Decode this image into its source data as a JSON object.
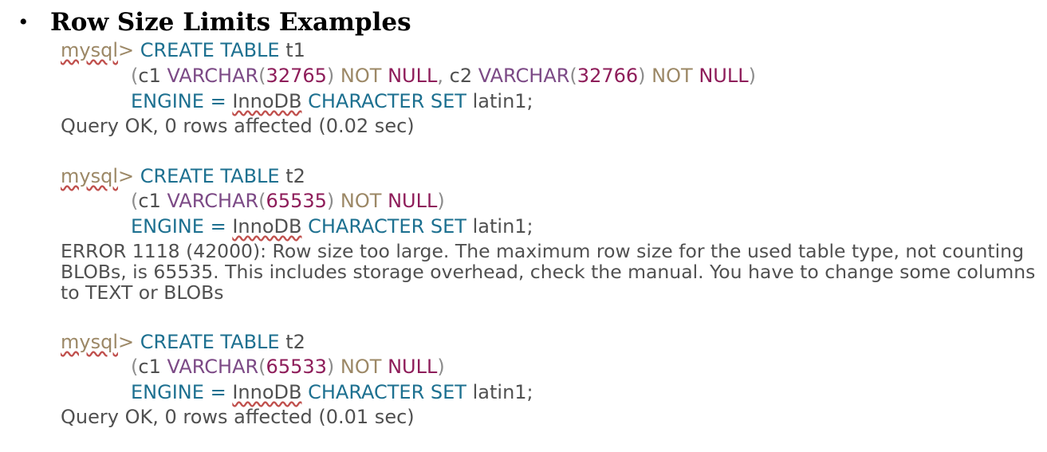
{
  "slide": {
    "bullet": "•",
    "title": "Row Size Limits Examples"
  },
  "examples": [
    {
      "prompt": "mysql",
      "prompt_gt": ">",
      "create": "CREATE TABLE",
      "table": "t1",
      "cols_open": "(",
      "col1": "c1",
      "col1_type": "VARCHAR",
      "col1_lp": "(",
      "col1_len": "32765",
      "col1_rp": ")",
      "col1_not": "NOT",
      "col1_null": "NULL",
      "sep": ",",
      "col2": "c2",
      "col2_type": "VARCHAR",
      "col2_lp": "(",
      "col2_len": "32766",
      "col2_rp": ")",
      "col2_not": "NOT",
      "col2_null": "NULL",
      "cols_close": ")",
      "engine": "ENGINE",
      "eq": "=",
      "innodb": "InnoDB",
      "charset": "CHARACTER SET",
      "latin": "latin1;",
      "result": "Query OK, 0 rows affected (0.02 sec)"
    },
    {
      "prompt": "mysql",
      "prompt_gt": ">",
      "create": "CREATE TABLE",
      "table": "t2",
      "cols_open": "(",
      "col1": "c1",
      "col1_type": "VARCHAR",
      "col1_lp": "(",
      "col1_len": "65535",
      "col1_rp": ")",
      "col1_not": "NOT",
      "col1_null": "NULL",
      "cols_close": ")",
      "engine": "ENGINE",
      "eq": "=",
      "innodb": "InnoDB",
      "charset": "CHARACTER SET",
      "latin": "latin1;",
      "error": "ERROR 1118 (42000): Row size too large. The maximum row size for the used table type, not counting BLOBs, is 65535. This includes storage overhead, check the manual. You have to change some columns to TEXT or BLOBs"
    },
    {
      "prompt": "mysql",
      "prompt_gt": ">",
      "create": "CREATE TABLE",
      "table": "t2",
      "cols_open": "(",
      "col1": "c1",
      "col1_type": "VARCHAR",
      "col1_lp": "(",
      "col1_len": "65533",
      "col1_rp": ")",
      "col1_not": "NOT",
      "col1_null": "NULL",
      "cols_close": ")",
      "engine": "ENGINE",
      "eq": "=",
      "innodb": "InnoDB",
      "charset": "CHARACTER SET",
      "latin": "latin1;",
      "result": "Query OK, 0 rows affected (0.01 sec)"
    }
  ]
}
